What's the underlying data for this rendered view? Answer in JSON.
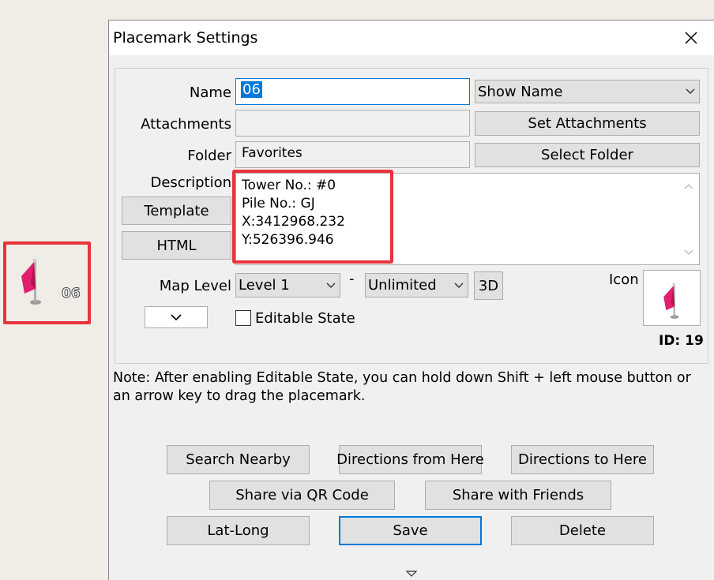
{
  "window": {
    "title": "Placemark Settings"
  },
  "map_marker": {
    "label": "06"
  },
  "form": {
    "name_label": "Name",
    "name_value": "06",
    "show_name_option": "Show Name",
    "attachments_label": "Attachments",
    "attachments_value": "",
    "set_attachments_button": "Set Attachments",
    "folder_label": "Folder",
    "folder_value": "Favorites",
    "select_folder_button": "Select Folder",
    "description_label": "Description",
    "description_lines": [
      "Tower No.: #0",
      "Pile No.: GJ",
      "X:3412968.232",
      "Y:526396.946"
    ],
    "template_button": "Template",
    "html_button": "HTML",
    "map_level_label": "Map Level",
    "map_level_min": "Level 1",
    "map_level_separator": "-",
    "map_level_max": "Unlimited",
    "three_d_button": "3D",
    "icon_label": "Icon",
    "editable_state_label": "Editable State",
    "editable_state_checked": false,
    "id_label": "ID: 19"
  },
  "note": "Note: After enabling Editable State, you can hold down Shift + left mouse button or an arrow key to drag the placemark.",
  "buttons": {
    "search_nearby": "Search Nearby",
    "directions_from": "Directions from Here",
    "directions_to": "Directions to Here",
    "share_qr": "Share via QR Code",
    "share_friends": "Share with Friends",
    "lat_long": "Lat-Long",
    "save": "Save",
    "delete": "Delete"
  },
  "icons": {
    "flag": "flag-icon",
    "close": "close-icon",
    "chevron": "chevron-down-icon",
    "scroll_up": "scroll-up-icon",
    "scroll_down": "scroll-down-icon",
    "more": "more-arrow-icon"
  },
  "colors": {
    "flag_pink": "#e0206f",
    "highlight_border": "#e8333d",
    "selection_bg": "#0078d7",
    "default_button_border": "#0078d7"
  }
}
